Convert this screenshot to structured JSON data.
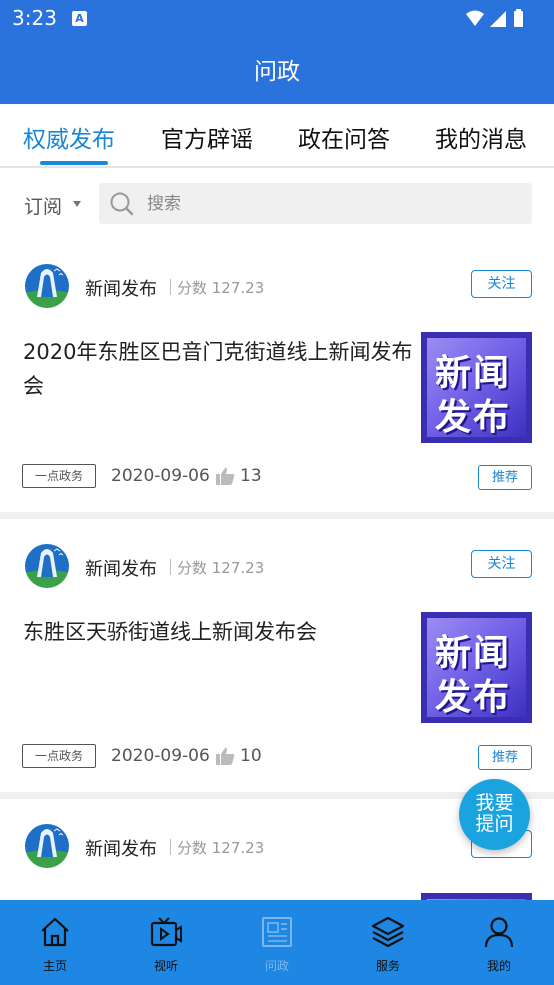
{
  "status_bar": {
    "time": "3:23",
    "app_indicator": "A"
  },
  "app_bar": {
    "title": "问政"
  },
  "tabs": [
    {
      "label": "权威发布",
      "active": true
    },
    {
      "label": "官方辟谣",
      "active": false
    },
    {
      "label": "政在问答",
      "active": false
    },
    {
      "label": "我的消息",
      "active": false
    }
  ],
  "filter": {
    "subscribe_label": "订阅",
    "search_placeholder": "搜索"
  },
  "cards": [
    {
      "source_name": "新闻发布",
      "score": "分数 127.23",
      "follow_label": "关注",
      "headline": "2020年东胜区巴音门克街道线上新闻发布会",
      "thumb_line1": "新闻",
      "thumb_line2": "发布",
      "tag": "一点政务",
      "date": "2020-09-06",
      "likes": "13",
      "recommend_label": "推荐"
    },
    {
      "source_name": "新闻发布",
      "score": "分数 127.23",
      "follow_label": "关注",
      "headline": "东胜区天骄街道线上新闻发布会",
      "thumb_line1": "新闻",
      "thumb_line2": "发布",
      "tag": "一点政务",
      "date": "2020-09-06",
      "likes": "10",
      "recommend_label": "推荐"
    },
    {
      "source_name": "新闻发布",
      "score": "分数 127.23"
    }
  ],
  "fab": {
    "line1": "我要",
    "line2": "提问"
  },
  "bottom_nav": [
    {
      "label": "主页",
      "icon": "home-icon"
    },
    {
      "label": "视听",
      "icon": "tv-icon"
    },
    {
      "label": "问政",
      "icon": "document-icon",
      "active": true
    },
    {
      "label": "服务",
      "icon": "layers-icon"
    },
    {
      "label": "我的",
      "icon": "person-icon"
    }
  ],
  "colors": {
    "primary": "#2b73dc",
    "accent": "#1a86d8",
    "tabbar": "#1e86e3",
    "fab": "#1ba3e0"
  }
}
